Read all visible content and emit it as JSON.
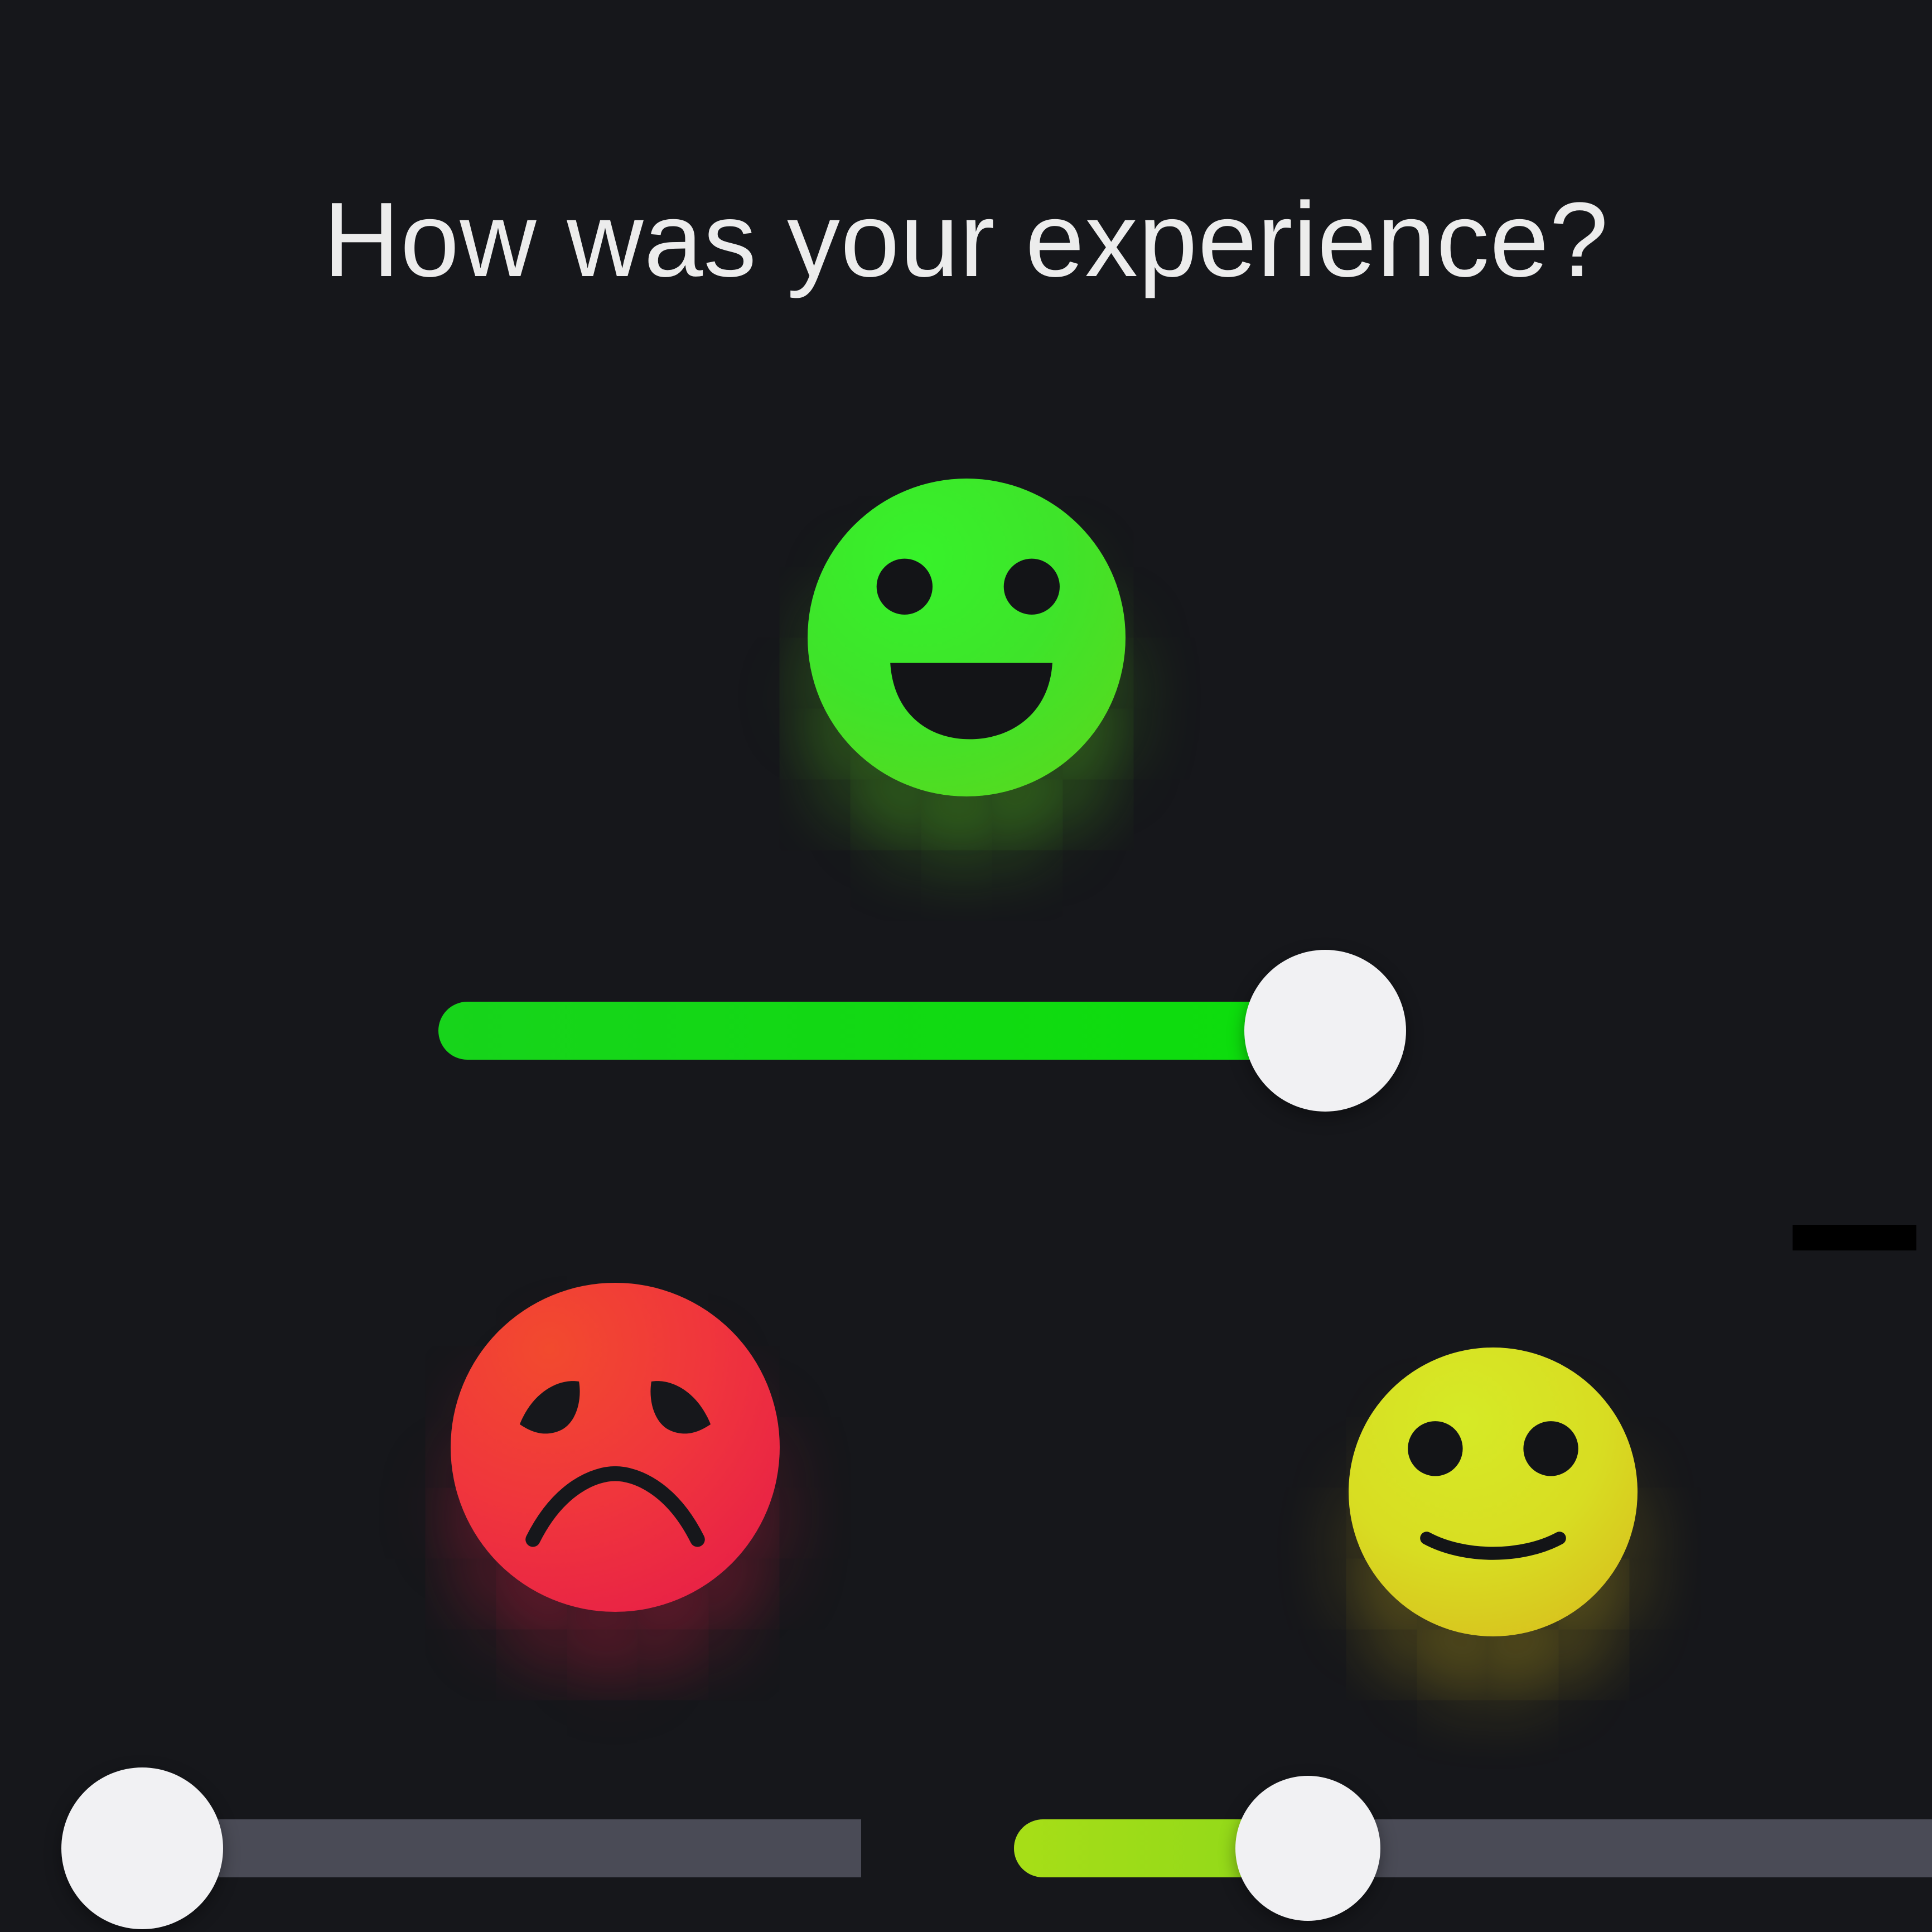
{
  "title": "How was your experience?",
  "ratings": [
    {
      "id": "top",
      "emoji": "big-grin-face-icon",
      "color": "#3ee42a",
      "slider_value": 0.85
    },
    {
      "id": "left",
      "emoji": "sad-face-icon",
      "color": "#f0363c",
      "slider_value": 0.09
    },
    {
      "id": "right",
      "emoji": "slight-smile-face-icon",
      "color": "#d8dd22",
      "slider_value": 0.32
    }
  ],
  "colors": {
    "background": "#16171b",
    "track": "#4a4b56",
    "thumb": "#f1f1f3"
  }
}
